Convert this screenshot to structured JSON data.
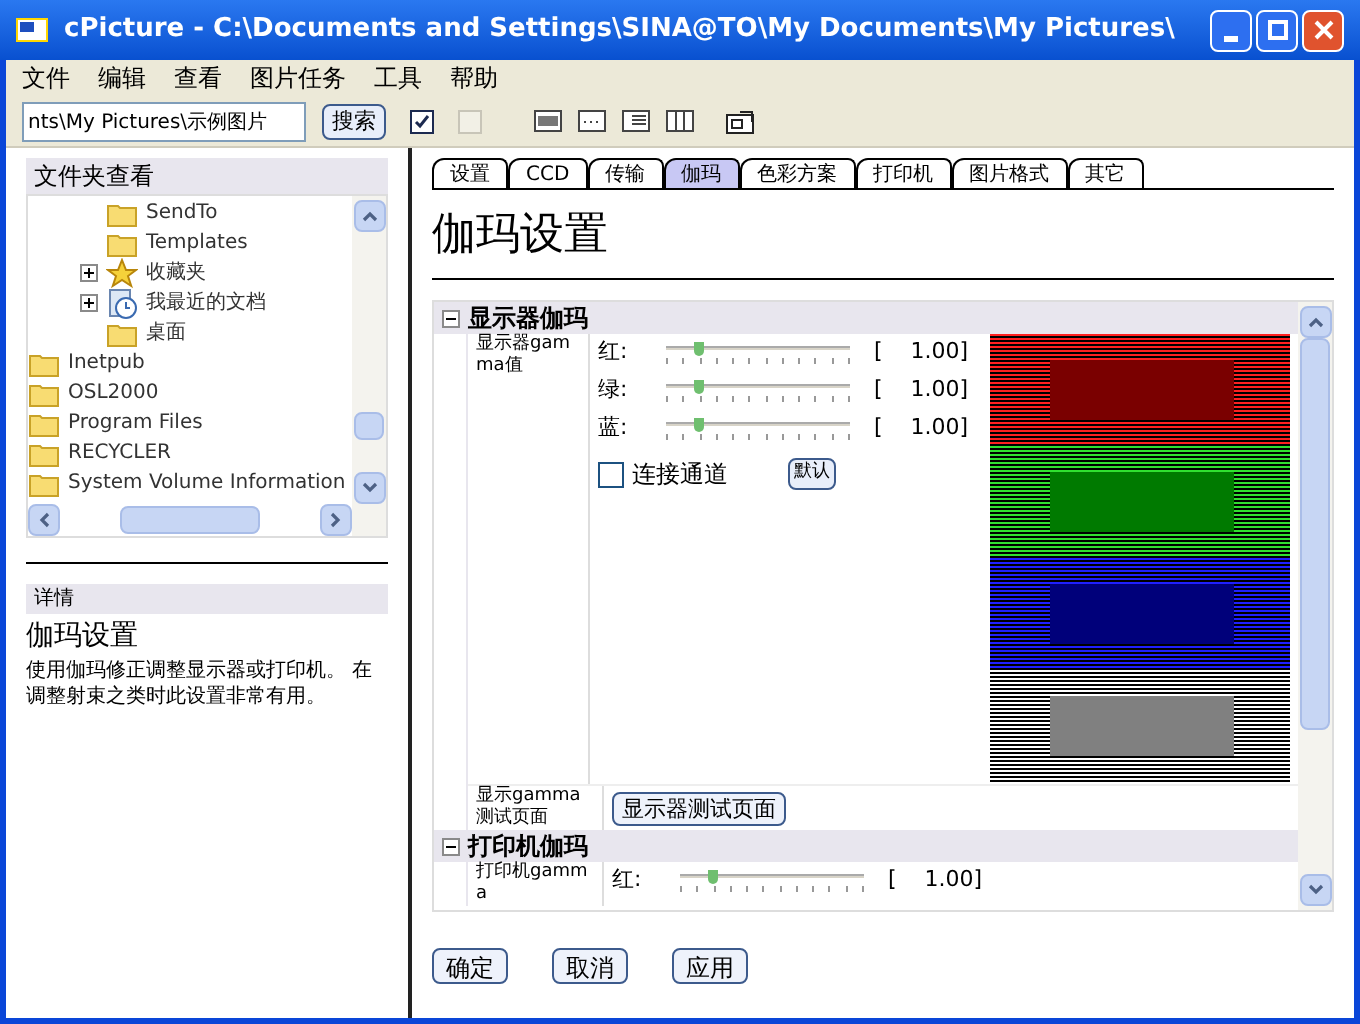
{
  "window": {
    "title": "cPicture - C:\\Documents and Settings\\SINA@TO\\My Documents\\My Pictures\\"
  },
  "menu": [
    "文件",
    "编辑",
    "查看",
    "图片任务",
    "工具",
    "帮助"
  ],
  "toolbar": {
    "path": "nts\\My Pictures\\示例图片",
    "search_button": "搜索",
    "toggles": [
      {
        "checked": true,
        "disabled": false
      },
      {
        "checked": false,
        "disabled": true
      }
    ]
  },
  "folder_panel": {
    "title": "文件夹查看",
    "tree": [
      {
        "children": [
          {
            "label": "SendTo",
            "kind": "folder"
          },
          {
            "label": "Templates",
            "kind": "folder"
          },
          {
            "label": "收藏夹",
            "kind": "favorites",
            "expanded": false
          },
          {
            "label": "我最近的文档",
            "kind": "recent",
            "expanded": false
          },
          {
            "label": "桌面",
            "kind": "folder"
          }
        ]
      },
      {
        "label": "Inetpub",
        "kind": "folder"
      },
      {
        "label": "OSL2000",
        "kind": "folder"
      },
      {
        "label": "Program Files",
        "kind": "folder"
      },
      {
        "label": "RECYCLER",
        "kind": "folder"
      },
      {
        "label": "System Volume Information",
        "kind": "folder"
      }
    ]
  },
  "details": {
    "header": "详情",
    "title": "伽玛设置",
    "text": "使用伽玛修正调整显示器或打印机。 在调整射束之类时此设置非常有用。"
  },
  "tabs": [
    {
      "label": "设置",
      "selected": false
    },
    {
      "label": "CCD",
      "selected": false
    },
    {
      "label": "传输",
      "selected": false
    },
    {
      "label": "伽玛",
      "selected": true
    },
    {
      "label": "色彩方案",
      "selected": false
    },
    {
      "label": "打印机",
      "selected": false
    },
    {
      "label": "图片格式",
      "selected": false
    },
    {
      "label": "其它",
      "selected": false
    }
  ],
  "page_title": "伽玛设置",
  "sections": [
    {
      "title": "显示器伽玛",
      "expanded": true,
      "label": "显示器gamma值",
      "channels": [
        {
          "name": "红:",
          "level": 0.17,
          "reading": "[    1.00]"
        },
        {
          "name": "绿:",
          "level": 0.17,
          "reading": "[    1.00]"
        },
        {
          "name": "蓝:",
          "level": 0.17,
          "reading": "[    1.00]"
        }
      ],
      "link_channels": {
        "label": "连接通道",
        "checked": false
      },
      "default_button": "默认",
      "test_label": "显示gamma测试页面",
      "test_button": "显示器测试页面"
    },
    {
      "title": "打印机伽玛",
      "expanded": true,
      "label": "打印机gamma",
      "channels": [
        {
          "name": "红:",
          "level": 0.17,
          "reading": "[    1.00]"
        }
      ]
    }
  ],
  "buttons": [
    "确定",
    "取消",
    "应用"
  ]
}
